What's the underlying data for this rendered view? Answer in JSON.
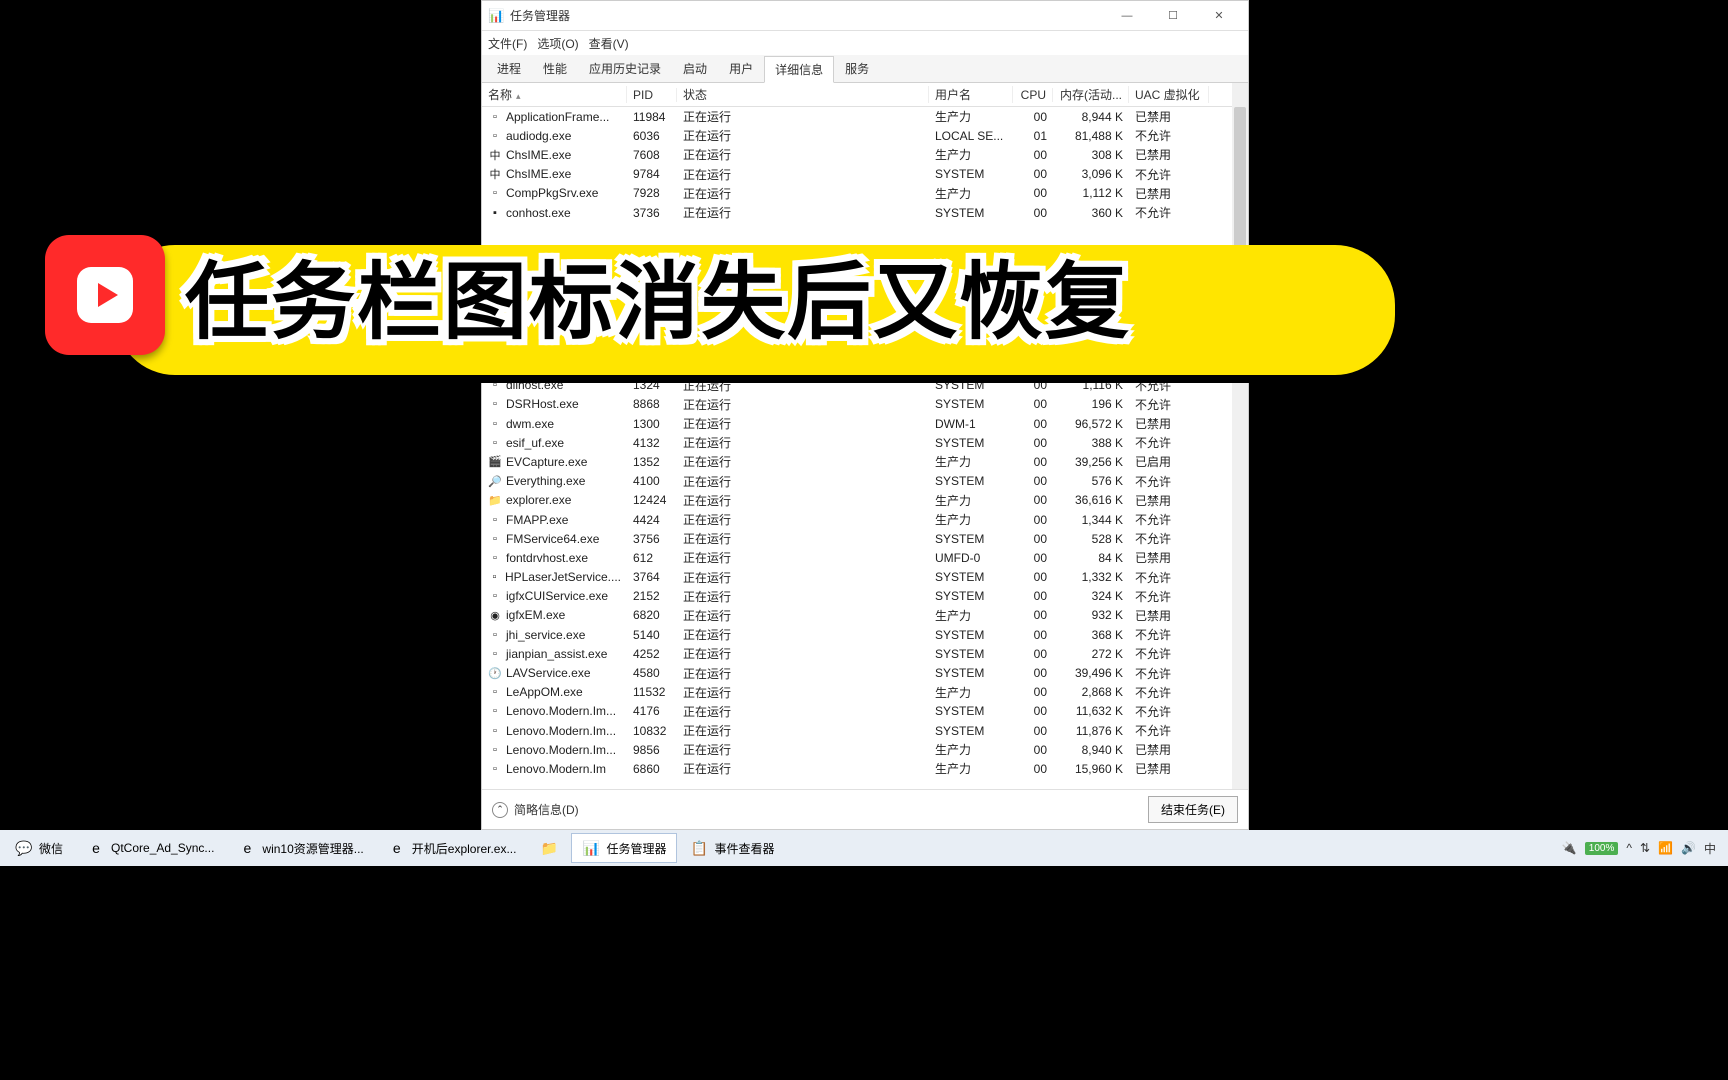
{
  "window": {
    "title": "任务管理器",
    "controls": {
      "min": "—",
      "max": "☐",
      "close": "✕"
    }
  },
  "menubar": [
    "文件(F)",
    "选项(O)",
    "查看(V)"
  ],
  "tabs": [
    "进程",
    "性能",
    "应用历史记录",
    "启动",
    "用户",
    "详细信息",
    "服务"
  ],
  "active_tab_index": 5,
  "columns": [
    "名称",
    "PID",
    "状态",
    "用户名",
    "CPU",
    "内存(活动...",
    "UAC 虚拟化"
  ],
  "footer": {
    "less": "简略信息(D)",
    "end_task": "结束任务(E)"
  },
  "processes": [
    {
      "icon": "▫",
      "name": "ApplicationFrame...",
      "pid": "11984",
      "status": "正在运行",
      "user": "生产力",
      "cpu": "00",
      "mem": "8,944 K",
      "uac": "已禁用"
    },
    {
      "icon": "▫",
      "name": "audiodg.exe",
      "pid": "6036",
      "status": "正在运行",
      "user": "LOCAL SE...",
      "cpu": "01",
      "mem": "81,488 K",
      "uac": "不允许"
    },
    {
      "icon": "中",
      "name": "ChsIME.exe",
      "pid": "7608",
      "status": "正在运行",
      "user": "生产力",
      "cpu": "00",
      "mem": "308 K",
      "uac": "已禁用"
    },
    {
      "icon": "中",
      "name": "ChsIME.exe",
      "pid": "9784",
      "status": "正在运行",
      "user": "SYSTEM",
      "cpu": "00",
      "mem": "3,096 K",
      "uac": "不允许"
    },
    {
      "icon": "▫",
      "name": "CompPkgSrv.exe",
      "pid": "7928",
      "status": "正在运行",
      "user": "生产力",
      "cpu": "00",
      "mem": "1,112 K",
      "uac": "已禁用"
    },
    {
      "icon": "▪",
      "name": "conhost.exe",
      "pid": "3736",
      "status": "正在运行",
      "user": "SYSTEM",
      "cpu": "00",
      "mem": "360 K",
      "uac": "不允许"
    },
    {
      "icon": "",
      "name": "",
      "pid": "",
      "status": "",
      "user": "",
      "cpu": "",
      "mem": "",
      "uac": ""
    },
    {
      "icon": "",
      "name": "",
      "pid": "",
      "status": "",
      "user": "",
      "cpu": "",
      "mem": "",
      "uac": ""
    },
    {
      "icon": "",
      "name": "",
      "pid": "",
      "status": "",
      "user": "",
      "cpu": "",
      "mem": "",
      "uac": ""
    },
    {
      "icon": "",
      "name": "",
      "pid": "",
      "status": "",
      "user": "",
      "cpu": "",
      "mem": "",
      "uac": ""
    },
    {
      "icon": "",
      "name": "",
      "pid": "",
      "status": "",
      "user": "",
      "cpu": "",
      "mem": "",
      "uac": ""
    },
    {
      "icon": "",
      "name": "",
      "pid": "",
      "status": "",
      "user": "",
      "cpu": "",
      "mem": "",
      "uac": ""
    },
    {
      "icon": "",
      "name": "",
      "pid": "",
      "status": "",
      "user": "",
      "cpu": "",
      "mem": "",
      "uac": ""
    },
    {
      "icon": "",
      "name": "",
      "pid": "",
      "status": "",
      "user": "",
      "cpu": "",
      "mem": "",
      "uac": ""
    },
    {
      "icon": "▫",
      "name": "dllhost.exe",
      "pid": "1324",
      "status": "正在运行",
      "user": "SYSTEM",
      "cpu": "00",
      "mem": "1,116 K",
      "uac": "不允许"
    },
    {
      "icon": "▫",
      "name": "DSRHost.exe",
      "pid": "8868",
      "status": "正在运行",
      "user": "SYSTEM",
      "cpu": "00",
      "mem": "196 K",
      "uac": "不允许"
    },
    {
      "icon": "▫",
      "name": "dwm.exe",
      "pid": "1300",
      "status": "正在运行",
      "user": "DWM-1",
      "cpu": "00",
      "mem": "96,572 K",
      "uac": "已禁用"
    },
    {
      "icon": "▫",
      "name": "esif_uf.exe",
      "pid": "4132",
      "status": "正在运行",
      "user": "SYSTEM",
      "cpu": "00",
      "mem": "388 K",
      "uac": "不允许"
    },
    {
      "icon": "🎬",
      "name": "EVCapture.exe",
      "pid": "1352",
      "status": "正在运行",
      "user": "生产力",
      "cpu": "00",
      "mem": "39,256 K",
      "uac": "已启用"
    },
    {
      "icon": "🔎",
      "name": "Everything.exe",
      "pid": "4100",
      "status": "正在运行",
      "user": "SYSTEM",
      "cpu": "00",
      "mem": "576 K",
      "uac": "不允许"
    },
    {
      "icon": "📁",
      "name": "explorer.exe",
      "pid": "12424",
      "status": "正在运行",
      "user": "生产力",
      "cpu": "00",
      "mem": "36,616 K",
      "uac": "已禁用"
    },
    {
      "icon": "▫",
      "name": "FMAPP.exe",
      "pid": "4424",
      "status": "正在运行",
      "user": "生产力",
      "cpu": "00",
      "mem": "1,344 K",
      "uac": "不允许"
    },
    {
      "icon": "▫",
      "name": "FMService64.exe",
      "pid": "3756",
      "status": "正在运行",
      "user": "SYSTEM",
      "cpu": "00",
      "mem": "528 K",
      "uac": "不允许"
    },
    {
      "icon": "▫",
      "name": "fontdrvhost.exe",
      "pid": "612",
      "status": "正在运行",
      "user": "UMFD-0",
      "cpu": "00",
      "mem": "84 K",
      "uac": "已禁用"
    },
    {
      "icon": "▫",
      "name": "HPLaserJetService....",
      "pid": "3764",
      "status": "正在运行",
      "user": "SYSTEM",
      "cpu": "00",
      "mem": "1,332 K",
      "uac": "不允许"
    },
    {
      "icon": "▫",
      "name": "igfxCUIService.exe",
      "pid": "2152",
      "status": "正在运行",
      "user": "SYSTEM",
      "cpu": "00",
      "mem": "324 K",
      "uac": "不允许"
    },
    {
      "icon": "◉",
      "name": "igfxEM.exe",
      "pid": "6820",
      "status": "正在运行",
      "user": "生产力",
      "cpu": "00",
      "mem": "932 K",
      "uac": "已禁用"
    },
    {
      "icon": "▫",
      "name": "jhi_service.exe",
      "pid": "5140",
      "status": "正在运行",
      "user": "SYSTEM",
      "cpu": "00",
      "mem": "368 K",
      "uac": "不允许"
    },
    {
      "icon": "▫",
      "name": "jianpian_assist.exe",
      "pid": "4252",
      "status": "正在运行",
      "user": "SYSTEM",
      "cpu": "00",
      "mem": "272 K",
      "uac": "不允许"
    },
    {
      "icon": "🕐",
      "name": "LAVService.exe",
      "pid": "4580",
      "status": "正在运行",
      "user": "SYSTEM",
      "cpu": "00",
      "mem": "39,496 K",
      "uac": "不允许"
    },
    {
      "icon": "▫",
      "name": "LeAppOM.exe",
      "pid": "11532",
      "status": "正在运行",
      "user": "生产力",
      "cpu": "00",
      "mem": "2,868 K",
      "uac": "不允许"
    },
    {
      "icon": "▫",
      "name": "Lenovo.Modern.Im...",
      "pid": "4176",
      "status": "正在运行",
      "user": "SYSTEM",
      "cpu": "00",
      "mem": "11,632 K",
      "uac": "不允许"
    },
    {
      "icon": "▫",
      "name": "Lenovo.Modern.Im...",
      "pid": "10832",
      "status": "正在运行",
      "user": "SYSTEM",
      "cpu": "00",
      "mem": "11,876 K",
      "uac": "不允许"
    },
    {
      "icon": "▫",
      "name": "Lenovo.Modern.Im...",
      "pid": "9856",
      "status": "正在运行",
      "user": "生产力",
      "cpu": "00",
      "mem": "8,940 K",
      "uac": "已禁用"
    },
    {
      "icon": "▫",
      "name": "Lenovo.Modern.Im",
      "pid": "6860",
      "status": "正在运行",
      "user": "生产力",
      "cpu": "00",
      "mem": "15,960 K",
      "uac": "已禁用"
    }
  ],
  "banner": {
    "text": "任务栏图标消失后又恢复"
  },
  "taskbar": {
    "items": [
      {
        "icon": "💬",
        "label": "微信"
      },
      {
        "icon": "e",
        "label": "QtCore_Ad_Sync..."
      },
      {
        "icon": "e",
        "label": "win10资源管理器..."
      },
      {
        "icon": "e",
        "label": "开机后explorer.ex..."
      },
      {
        "icon": "📁",
        "label": ""
      },
      {
        "icon": "📊",
        "label": "任务管理器",
        "active": true
      },
      {
        "icon": "📋",
        "label": "事件查看器"
      }
    ],
    "tray": {
      "battery": "100%",
      "ime": "中",
      "chevron": "^"
    }
  }
}
